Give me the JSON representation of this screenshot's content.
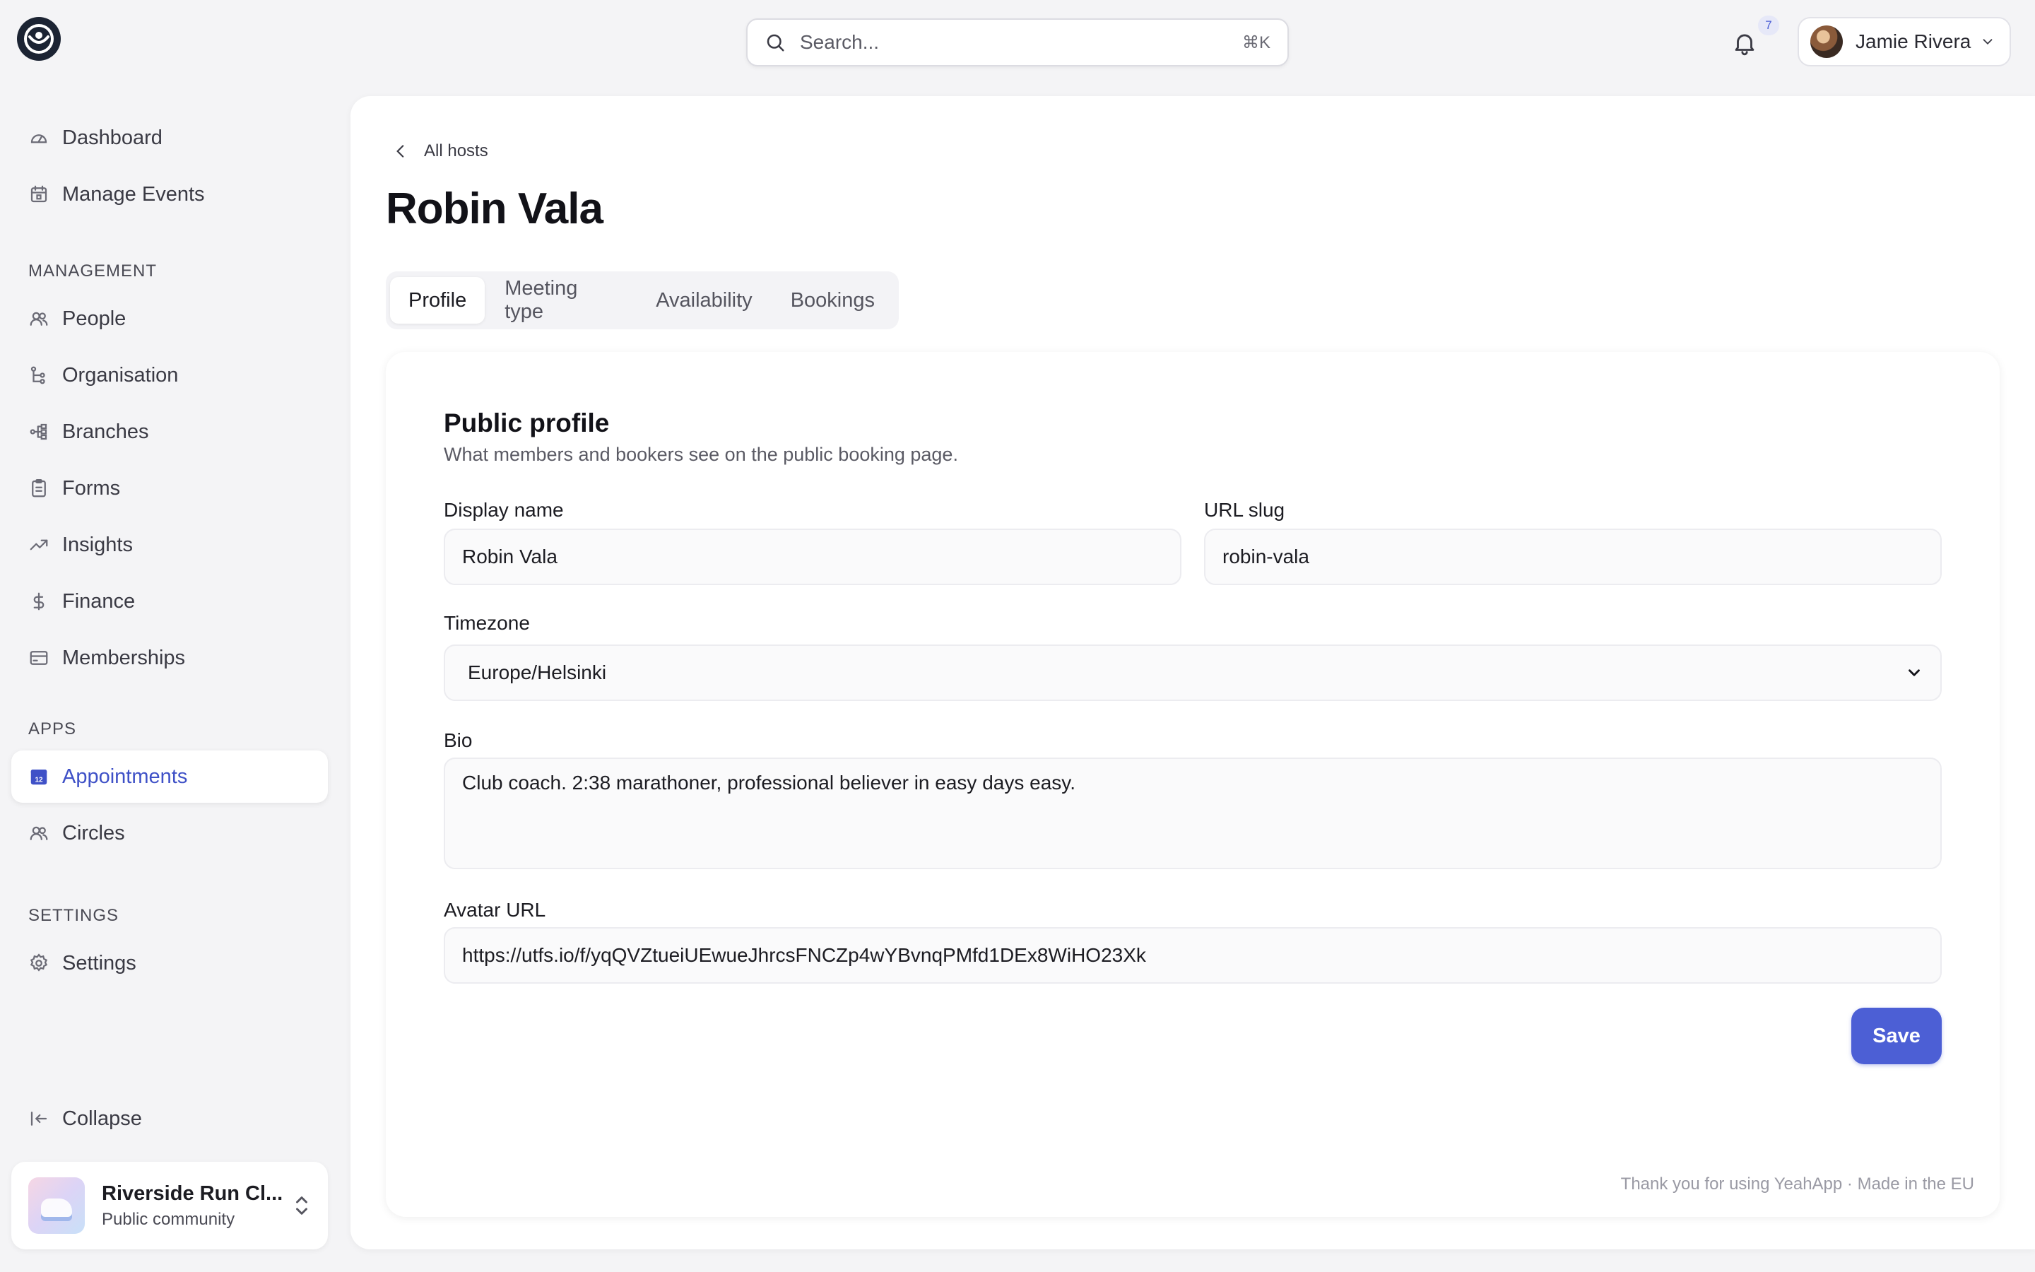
{
  "header": {
    "search_placeholder": "Search...",
    "search_shortcut": "⌘K",
    "notification_count": "7",
    "user_name": "Jamie Rivera"
  },
  "sidebar": {
    "top_items": [
      {
        "label": "Dashboard",
        "icon": "gauge-icon"
      },
      {
        "label": "Manage Events",
        "icon": "calendar-icon"
      }
    ],
    "management_label": "MANAGEMENT",
    "management_items": [
      {
        "label": "People",
        "icon": "users-icon"
      },
      {
        "label": "Organisation",
        "icon": "org-tree-icon"
      },
      {
        "label": "Branches",
        "icon": "branches-icon"
      },
      {
        "label": "Forms",
        "icon": "clipboard-icon"
      },
      {
        "label": "Insights",
        "icon": "trend-up-icon"
      },
      {
        "label": "Finance",
        "icon": "dollar-icon"
      },
      {
        "label": "Memberships",
        "icon": "card-icon"
      }
    ],
    "apps_label": "APPS",
    "apps_items": [
      {
        "label": "Appointments",
        "icon": "calendar-12-icon",
        "active": true
      },
      {
        "label": "Circles",
        "icon": "users-icon"
      }
    ],
    "settings_label": "SETTINGS",
    "settings_items": [
      {
        "label": "Settings",
        "icon": "gear-icon"
      }
    ],
    "collapse_label": "Collapse",
    "org": {
      "name": "Riverside Run Cl...",
      "subtitle": "Public community"
    }
  },
  "main": {
    "breadcrumb": "All hosts",
    "title": "Robin Vala",
    "tabs": [
      "Profile",
      "Meeting type",
      "Availability",
      "Bookings"
    ],
    "active_tab": "Profile",
    "form": {
      "title": "Public profile",
      "description": "What members and bookers see on the public booking page.",
      "display_name_label": "Display name",
      "display_name_value": "Robin Vala",
      "url_slug_label": "URL slug",
      "url_slug_value": "robin-vala",
      "timezone_label": "Timezone",
      "timezone_value": "Europe/Helsinki",
      "bio_label": "Bio",
      "bio_value": "Club coach. 2:38 marathoner, professional believer in easy days easy.",
      "avatar_url_label": "Avatar URL",
      "avatar_url_value": "https://utfs.io/f/yqQVZtueiUEwueJhrcsFNCZp4wYBvnqPMfd1DEx8WiHO23Xk",
      "save_label": "Save"
    },
    "footer": "Thank you for using YeahApp · Made in the EU"
  },
  "colors": {
    "accent": "#4c5fd5",
    "background": "#f4f4f6",
    "surface": "#ffffff"
  }
}
